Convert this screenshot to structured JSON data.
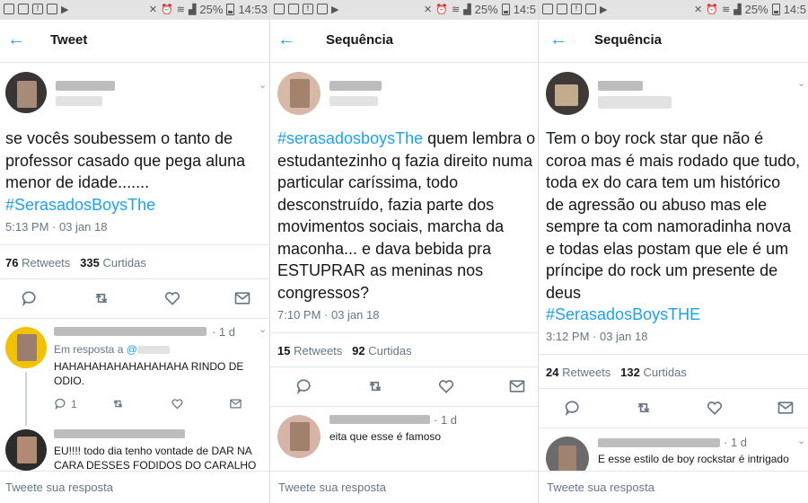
{
  "status_bar": {
    "battery": "25%",
    "time": "14:53",
    "time_truncated": "14:5",
    "icons": [
      "image-icon",
      "clipboard-icon",
      "alert-icon",
      "gallery-icon",
      "play-icon",
      "mute-icon",
      "alarm-icon",
      "wifi-icon",
      "signal-icon",
      "battery-icon"
    ]
  },
  "colors": {
    "accent": "#1da1f2",
    "muted": "#657786",
    "text": "#14171a",
    "border": "#e1e8ed"
  },
  "panels": [
    {
      "header_title": "Tweet",
      "tweet": {
        "text": "se vocês soubessem o tanto de professor casado que pega aluna menor de idade.......",
        "hashtag": "#SerasadosBoysThe",
        "time": "5:13 PM · 03 jan 18",
        "retweets_count": "76",
        "retweets_label": "Retweets",
        "likes_count": "335",
        "likes_label": "Curtidas"
      },
      "replies": [
        {
          "age": "· 1 d",
          "in_reply_prefix": "Em resposta a",
          "in_reply_handle": "@",
          "text": "HAHAHAHAHAHAHAHAHA RINDO DE ODIO.",
          "reply_count": "1"
        },
        {
          "text": "EU!!!! todo dia tenho vontade de DAR NA CARA DESSES FODIDOS DO CARALHO"
        }
      ],
      "footer": "Tweete sua resposta"
    },
    {
      "header_title": "Sequência",
      "tweet": {
        "hashtag": "#serasadosboysThe",
        "text": "quem lembra o estudantezinho q fazia direito numa particular caríssima, todo desconstruído, fazia parte dos movimentos sociais, marcha da maconha... e dava bebida pra ESTUPRAR as meninas nos congressos?",
        "time": "7:10 PM · 03 jan 18",
        "retweets_count": "15",
        "retweets_label": "Retweets",
        "likes_count": "92",
        "likes_label": "Curtidas"
      },
      "replies": [
        {
          "age": "· 1 d",
          "text": "eita que esse é famoso"
        }
      ],
      "footer": "Tweete sua resposta"
    },
    {
      "header_title": "Sequência",
      "tweet": {
        "text": "Tem o boy rock star que não é coroa mas é mais rodado que tudo, toda ex do cara tem um histórico de agressão ou abuso mas ele sempre ta com namoradinha nova e todas elas postam que ele é um príncipe do rock um presente de deus",
        "hashtag": "#SerasadosBoysTHE",
        "time": "3:12 PM · 03 jan 18",
        "retweets_count": "24",
        "retweets_label": "Retweets",
        "likes_count": "132",
        "likes_label": "Curtidas"
      },
      "replies": [
        {
          "age": "· 1 d",
          "text": "E esse estilo de boy rockstar é intrigado"
        }
      ],
      "footer": "Tweete sua resposta"
    }
  ]
}
